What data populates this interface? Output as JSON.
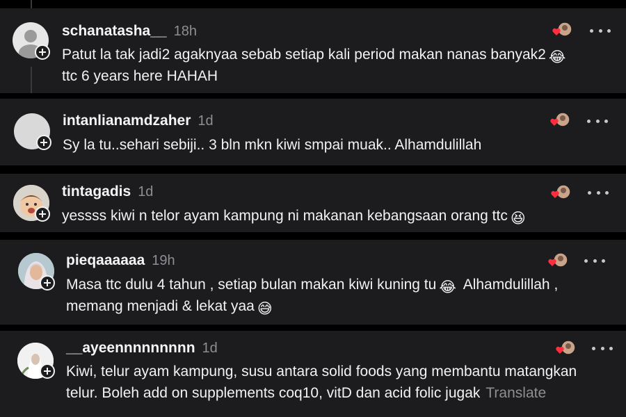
{
  "comments": [
    {
      "username": "schanatasha__",
      "time": "18h",
      "line1": "Patut la tak jadi2 agaknyaa sebab setiap kali period makan nanas banyak2",
      "line1_emoji": "😂",
      "line2": "ttc 6 years here HAHAH",
      "avatar": "default-avatar"
    },
    {
      "username": "intanlianamdzaher",
      "time": "1d",
      "line1": "Sy la tu..sehari sebiji.. 3 bln mkn kiwi smpai muak.. Alhamdulillah",
      "avatar": "blank-avatar"
    },
    {
      "username": "tintagadis",
      "time": "1d",
      "line1": "yessss kiwi n telor ayam kampung ni makanan kebangsaan orang ttc",
      "line1_emoji": "😆",
      "avatar": "child-photo-avatar"
    },
    {
      "username": "pieqaaaaaa",
      "time": "19h",
      "line1a": "Masa ttc dulu 4 tahun , setiap bulan makan kiwi kuning tu",
      "line1_emoji": "😂",
      "line1b": "Alhamdulillah ,",
      "line2": "memang menjadi & lekat yaa",
      "line2_emoji": "😅",
      "avatar": "hijab-photo-avatar"
    },
    {
      "username": "__ayeennnnnnnnn",
      "time": "1d",
      "line1": "Kiwi, telur ayam kampung, susu antara solid foods yang membantu matangkan",
      "line2": "telur. Boleh add on supplements coq10, vitD dan acid folic jugak",
      "translate": "Translate",
      "avatar": "white-photo-avatar"
    }
  ],
  "colors": {
    "card_bg": "#1c1c1e",
    "page_bg": "#000000",
    "muted": "#8e8e93",
    "heart": "#ff2d3d"
  },
  "icons": [
    "plus-icon",
    "heart-icon",
    "more-icon",
    "emoji-icon"
  ]
}
